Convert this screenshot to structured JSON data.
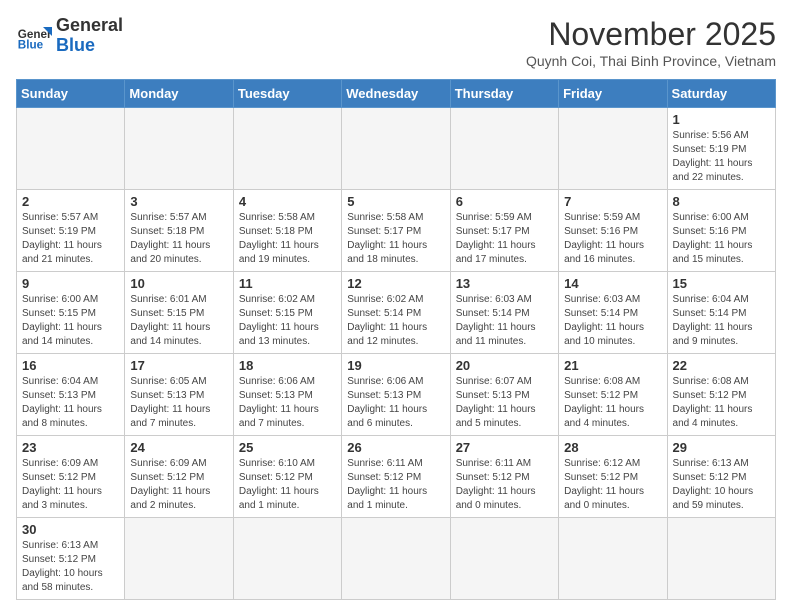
{
  "header": {
    "logo_general": "General",
    "logo_blue": "Blue",
    "month_title": "November 2025",
    "location": "Quynh Coi, Thai Binh Province, Vietnam"
  },
  "weekdays": [
    "Sunday",
    "Monday",
    "Tuesday",
    "Wednesday",
    "Thursday",
    "Friday",
    "Saturday"
  ],
  "days": {
    "d1": {
      "num": "1",
      "info": "Sunrise: 5:56 AM\nSunset: 5:19 PM\nDaylight: 11 hours and 22 minutes."
    },
    "d2": {
      "num": "2",
      "info": "Sunrise: 5:57 AM\nSunset: 5:19 PM\nDaylight: 11 hours and 21 minutes."
    },
    "d3": {
      "num": "3",
      "info": "Sunrise: 5:57 AM\nSunset: 5:18 PM\nDaylight: 11 hours and 20 minutes."
    },
    "d4": {
      "num": "4",
      "info": "Sunrise: 5:58 AM\nSunset: 5:18 PM\nDaylight: 11 hours and 19 minutes."
    },
    "d5": {
      "num": "5",
      "info": "Sunrise: 5:58 AM\nSunset: 5:17 PM\nDaylight: 11 hours and 18 minutes."
    },
    "d6": {
      "num": "6",
      "info": "Sunrise: 5:59 AM\nSunset: 5:17 PM\nDaylight: 11 hours and 17 minutes."
    },
    "d7": {
      "num": "7",
      "info": "Sunrise: 5:59 AM\nSunset: 5:16 PM\nDaylight: 11 hours and 16 minutes."
    },
    "d8": {
      "num": "8",
      "info": "Sunrise: 6:00 AM\nSunset: 5:16 PM\nDaylight: 11 hours and 15 minutes."
    },
    "d9": {
      "num": "9",
      "info": "Sunrise: 6:00 AM\nSunset: 5:15 PM\nDaylight: 11 hours and 14 minutes."
    },
    "d10": {
      "num": "10",
      "info": "Sunrise: 6:01 AM\nSunset: 5:15 PM\nDaylight: 11 hours and 14 minutes."
    },
    "d11": {
      "num": "11",
      "info": "Sunrise: 6:02 AM\nSunset: 5:15 PM\nDaylight: 11 hours and 13 minutes."
    },
    "d12": {
      "num": "12",
      "info": "Sunrise: 6:02 AM\nSunset: 5:14 PM\nDaylight: 11 hours and 12 minutes."
    },
    "d13": {
      "num": "13",
      "info": "Sunrise: 6:03 AM\nSunset: 5:14 PM\nDaylight: 11 hours and 11 minutes."
    },
    "d14": {
      "num": "14",
      "info": "Sunrise: 6:03 AM\nSunset: 5:14 PM\nDaylight: 11 hours and 10 minutes."
    },
    "d15": {
      "num": "15",
      "info": "Sunrise: 6:04 AM\nSunset: 5:14 PM\nDaylight: 11 hours and 9 minutes."
    },
    "d16": {
      "num": "16",
      "info": "Sunrise: 6:04 AM\nSunset: 5:13 PM\nDaylight: 11 hours and 8 minutes."
    },
    "d17": {
      "num": "17",
      "info": "Sunrise: 6:05 AM\nSunset: 5:13 PM\nDaylight: 11 hours and 7 minutes."
    },
    "d18": {
      "num": "18",
      "info": "Sunrise: 6:06 AM\nSunset: 5:13 PM\nDaylight: 11 hours and 7 minutes."
    },
    "d19": {
      "num": "19",
      "info": "Sunrise: 6:06 AM\nSunset: 5:13 PM\nDaylight: 11 hours and 6 minutes."
    },
    "d20": {
      "num": "20",
      "info": "Sunrise: 6:07 AM\nSunset: 5:13 PM\nDaylight: 11 hours and 5 minutes."
    },
    "d21": {
      "num": "21",
      "info": "Sunrise: 6:08 AM\nSunset: 5:12 PM\nDaylight: 11 hours and 4 minutes."
    },
    "d22": {
      "num": "22",
      "info": "Sunrise: 6:08 AM\nSunset: 5:12 PM\nDaylight: 11 hours and 4 minutes."
    },
    "d23": {
      "num": "23",
      "info": "Sunrise: 6:09 AM\nSunset: 5:12 PM\nDaylight: 11 hours and 3 minutes."
    },
    "d24": {
      "num": "24",
      "info": "Sunrise: 6:09 AM\nSunset: 5:12 PM\nDaylight: 11 hours and 2 minutes."
    },
    "d25": {
      "num": "25",
      "info": "Sunrise: 6:10 AM\nSunset: 5:12 PM\nDaylight: 11 hours and 1 minute."
    },
    "d26": {
      "num": "26",
      "info": "Sunrise: 6:11 AM\nSunset: 5:12 PM\nDaylight: 11 hours and 1 minute."
    },
    "d27": {
      "num": "27",
      "info": "Sunrise: 6:11 AM\nSunset: 5:12 PM\nDaylight: 11 hours and 0 minutes."
    },
    "d28": {
      "num": "28",
      "info": "Sunrise: 6:12 AM\nSunset: 5:12 PM\nDaylight: 11 hours and 0 minutes."
    },
    "d29": {
      "num": "29",
      "info": "Sunrise: 6:13 AM\nSunset: 5:12 PM\nDaylight: 10 hours and 59 minutes."
    },
    "d30": {
      "num": "30",
      "info": "Sunrise: 6:13 AM\nSunset: 5:12 PM\nDaylight: 10 hours and 58 minutes."
    }
  }
}
